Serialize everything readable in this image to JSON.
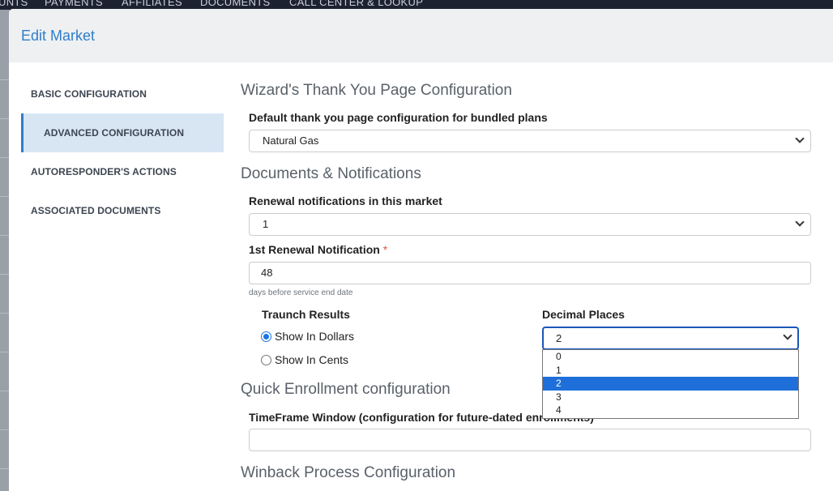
{
  "topnav": [
    "UNTS",
    "PAYMENTS",
    "AFFILIATES",
    "DOCUMENTS",
    "CALL CENTER & LOOKUP"
  ],
  "modal": {
    "title": "Edit Market"
  },
  "sidebar": {
    "items": [
      {
        "label": "BASIC CONFIGURATION",
        "active": false
      },
      {
        "label": "ADVANCED CONFIGURATION",
        "active": true
      },
      {
        "label": "AUTORESPONDER'S ACTIONS",
        "active": false
      },
      {
        "label": "ASSOCIATED DOCUMENTS",
        "active": false
      }
    ]
  },
  "wizard": {
    "title": "Wizard's Thank You Page Configuration",
    "default_label": "Default thank you page configuration for bundled plans",
    "default_value": "Natural Gas"
  },
  "documents": {
    "title": "Documents & Notifications",
    "renewal_label": "Renewal notifications in this market",
    "renewal_value": "1",
    "first_label": "1st Renewal Notification",
    "first_required": "*",
    "first_value": "48",
    "first_help": "days before service end date"
  },
  "traunch": {
    "label": "Traunch Results",
    "options": [
      "Show In Dollars",
      "Show In Cents"
    ],
    "selected": "Show In Dollars"
  },
  "decimal": {
    "label": "Decimal Places",
    "value": "2",
    "options": [
      "0",
      "1",
      "2",
      "3",
      "4"
    ],
    "highlighted": "2"
  },
  "quick": {
    "title": "Quick Enrollment configuration",
    "timeframe_label": "TimeFrame Window (configuration for future-dated enrollments)",
    "timeframe_value": ""
  },
  "winback": {
    "title": "Winback Process Configuration"
  },
  "colors": {
    "accent": "#2f7ec9",
    "active_nav_bg": "#d8e6f4",
    "dropdown_highlight": "#1e6fd9"
  }
}
